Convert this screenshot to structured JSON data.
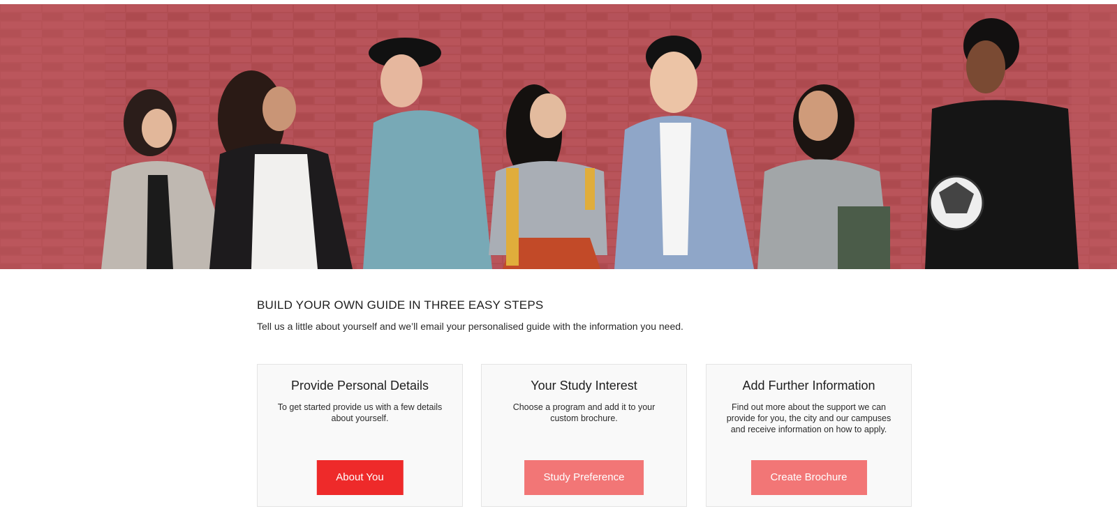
{
  "hero": {
    "image_description_icon": "group-of-students-photo-icon"
  },
  "intro": {
    "title": "BUILD YOUR OWN GUIDE IN THREE EASY STEPS",
    "subtitle": "Tell us a little about yourself and we’ll email your personalised guide with the information you need."
  },
  "steps": [
    {
      "title": "Provide Personal Details",
      "description": "To get started provide us with a few details about yourself.",
      "button_label": "About You",
      "button_color": "#ee2a2a"
    },
    {
      "title": "Your Study Interest",
      "description": "Choose a program and add it to your custom brochure.",
      "button_label": "Study Preference",
      "button_color": "#f27676"
    },
    {
      "title": "Add Further Information",
      "description": "Find out more about the support we can provide for you, the city and our campuses and receive information on how to apply.",
      "button_label": "Create Brochure",
      "button_color": "#f27676"
    }
  ],
  "colors": {
    "brick": "#b24a4f",
    "primary_button": "#ee2a2a",
    "secondary_button": "#f27676"
  }
}
